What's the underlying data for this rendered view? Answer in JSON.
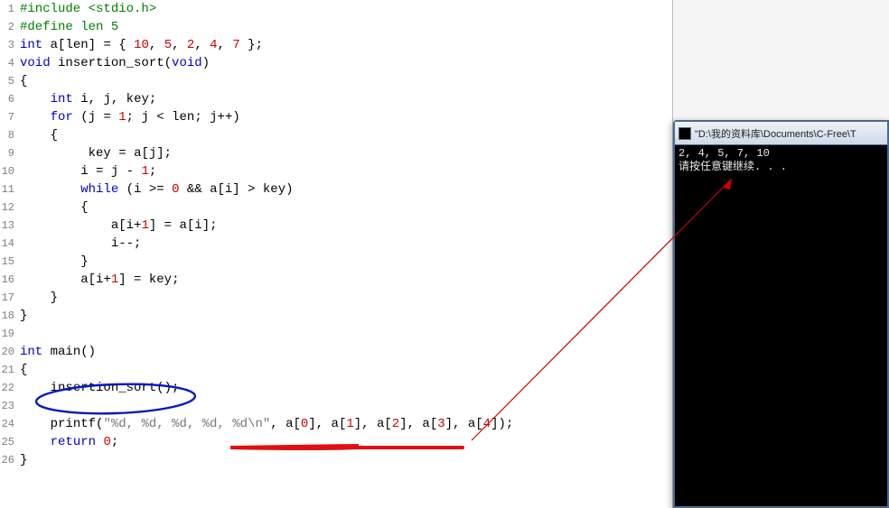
{
  "code": {
    "lines": [
      {
        "n": 1,
        "tokens": [
          [
            "preproc",
            "#include"
          ],
          [
            "preproc",
            " <stdio.h>"
          ]
        ]
      },
      {
        "n": 2,
        "tokens": [
          [
            "preproc",
            "#define"
          ],
          [
            "preproc",
            " len 5"
          ]
        ]
      },
      {
        "n": 3,
        "tokens": [
          [
            "kw-type",
            "int"
          ],
          [
            "ident",
            " a"
          ],
          [
            "op",
            "["
          ],
          [
            "ident",
            "len"
          ],
          [
            "op",
            "] = { "
          ],
          [
            "num",
            "10"
          ],
          [
            "op",
            ", "
          ],
          [
            "num",
            "5"
          ],
          [
            "op",
            ", "
          ],
          [
            "num",
            "2"
          ],
          [
            "op",
            ", "
          ],
          [
            "num",
            "4"
          ],
          [
            "op",
            ", "
          ],
          [
            "num",
            "7"
          ],
          [
            "op",
            " };"
          ]
        ]
      },
      {
        "n": 4,
        "tokens": [
          [
            "kw-type",
            "void"
          ],
          [
            "ident",
            " insertion_sort"
          ],
          [
            "op",
            "("
          ],
          [
            "kw-type",
            "void"
          ],
          [
            "op",
            ")"
          ]
        ]
      },
      {
        "n": 5,
        "tokens": [
          [
            "op",
            "{"
          ]
        ]
      },
      {
        "n": 6,
        "tokens": [
          [
            "op",
            "    "
          ],
          [
            "kw-type",
            "int"
          ],
          [
            "ident",
            " i"
          ],
          [
            "op",
            ", "
          ],
          [
            "ident",
            "j"
          ],
          [
            "op",
            ", "
          ],
          [
            "ident",
            "key"
          ],
          [
            "op",
            ";"
          ]
        ]
      },
      {
        "n": 7,
        "tokens": [
          [
            "op",
            "    "
          ],
          [
            "kw",
            "for"
          ],
          [
            "op",
            " ("
          ],
          [
            "ident",
            "j"
          ],
          [
            "op",
            " = "
          ],
          [
            "num",
            "1"
          ],
          [
            "op",
            "; "
          ],
          [
            "ident",
            "j"
          ],
          [
            "op",
            " < "
          ],
          [
            "ident",
            "len"
          ],
          [
            "op",
            "; "
          ],
          [
            "ident",
            "j"
          ],
          [
            "op",
            "++)"
          ]
        ]
      },
      {
        "n": 8,
        "tokens": [
          [
            "op",
            "    {"
          ]
        ]
      },
      {
        "n": 9,
        "tokens": [
          [
            "op",
            "         "
          ],
          [
            "ident",
            "key"
          ],
          [
            "op",
            " = "
          ],
          [
            "ident",
            "a"
          ],
          [
            "op",
            "["
          ],
          [
            "ident",
            "j"
          ],
          [
            "op",
            "];"
          ]
        ]
      },
      {
        "n": 10,
        "tokens": [
          [
            "op",
            "        "
          ],
          [
            "ident",
            "i"
          ],
          [
            "op",
            " = "
          ],
          [
            "ident",
            "j"
          ],
          [
            "op",
            " - "
          ],
          [
            "num",
            "1"
          ],
          [
            "op",
            ";"
          ]
        ]
      },
      {
        "n": 11,
        "tokens": [
          [
            "op",
            "        "
          ],
          [
            "kw",
            "while"
          ],
          [
            "op",
            " ("
          ],
          [
            "ident",
            "i"
          ],
          [
            "op",
            " >= "
          ],
          [
            "num",
            "0"
          ],
          [
            "op",
            " && "
          ],
          [
            "ident",
            "a"
          ],
          [
            "op",
            "["
          ],
          [
            "ident",
            "i"
          ],
          [
            "op",
            "] > "
          ],
          [
            "ident",
            "key"
          ],
          [
            "op",
            ")"
          ]
        ]
      },
      {
        "n": 12,
        "tokens": [
          [
            "op",
            "        {"
          ]
        ]
      },
      {
        "n": 13,
        "tokens": [
          [
            "op",
            "            "
          ],
          [
            "ident",
            "a"
          ],
          [
            "op",
            "["
          ],
          [
            "ident",
            "i"
          ],
          [
            "op",
            "+"
          ],
          [
            "num",
            "1"
          ],
          [
            "op",
            "] = "
          ],
          [
            "ident",
            "a"
          ],
          [
            "op",
            "["
          ],
          [
            "ident",
            "i"
          ],
          [
            "op",
            "];"
          ]
        ]
      },
      {
        "n": 14,
        "tokens": [
          [
            "op",
            "            "
          ],
          [
            "ident",
            "i"
          ],
          [
            "op",
            "--;"
          ]
        ]
      },
      {
        "n": 15,
        "tokens": [
          [
            "op",
            "        }"
          ]
        ]
      },
      {
        "n": 16,
        "tokens": [
          [
            "op",
            "        "
          ],
          [
            "ident",
            "a"
          ],
          [
            "op",
            "["
          ],
          [
            "ident",
            "i"
          ],
          [
            "op",
            "+"
          ],
          [
            "num",
            "1"
          ],
          [
            "op",
            "] = "
          ],
          [
            "ident",
            "key"
          ],
          [
            "op",
            ";"
          ]
        ]
      },
      {
        "n": 17,
        "tokens": [
          [
            "op",
            "    }"
          ]
        ]
      },
      {
        "n": 18,
        "tokens": [
          [
            "op",
            "}"
          ]
        ]
      },
      {
        "n": 19,
        "tokens": []
      },
      {
        "n": 20,
        "tokens": [
          [
            "kw-type",
            "int"
          ],
          [
            "ident",
            " main"
          ],
          [
            "op",
            "()"
          ]
        ]
      },
      {
        "n": 21,
        "tokens": [
          [
            "op",
            "{"
          ]
        ]
      },
      {
        "n": 22,
        "tokens": [
          [
            "op",
            "    "
          ],
          [
            "ident",
            "insertion_sort"
          ],
          [
            "op",
            "();"
          ]
        ]
      },
      {
        "n": 23,
        "tokens": []
      },
      {
        "n": 24,
        "tokens": [
          [
            "op",
            "    "
          ],
          [
            "ident",
            "printf"
          ],
          [
            "op",
            "("
          ],
          [
            "str",
            "\"%d, %d, %d, %d, %d\\n\""
          ],
          [
            "op",
            ", "
          ],
          [
            "ident",
            "a"
          ],
          [
            "op",
            "["
          ],
          [
            "num",
            "0"
          ],
          [
            "op",
            "], "
          ],
          [
            "ident",
            "a"
          ],
          [
            "op",
            "["
          ],
          [
            "num",
            "1"
          ],
          [
            "op",
            "], "
          ],
          [
            "ident",
            "a"
          ],
          [
            "op",
            "["
          ],
          [
            "num",
            "2"
          ],
          [
            "op",
            "], "
          ],
          [
            "ident",
            "a"
          ],
          [
            "op",
            "["
          ],
          [
            "num",
            "3"
          ],
          [
            "op",
            "], "
          ],
          [
            "ident",
            "a"
          ],
          [
            "op",
            "["
          ],
          [
            "num",
            "4"
          ],
          [
            "op",
            "]);"
          ]
        ]
      },
      {
        "n": 25,
        "tokens": [
          [
            "op",
            "    "
          ],
          [
            "kw",
            "return"
          ],
          [
            "op",
            " "
          ],
          [
            "num",
            "0"
          ],
          [
            "op",
            ";"
          ]
        ]
      },
      {
        "n": 26,
        "tokens": [
          [
            "op",
            "}"
          ]
        ]
      }
    ]
  },
  "console": {
    "title": "\"D:\\我的资料库\\Documents\\C-Free\\T",
    "lines": [
      "2, 4, 5, 7, 10",
      "请按任意键继续. . ."
    ]
  },
  "annotations": {
    "circle_color": "#0418c4",
    "underline_color": "#e01010",
    "arrow_color": "#cc0000"
  }
}
